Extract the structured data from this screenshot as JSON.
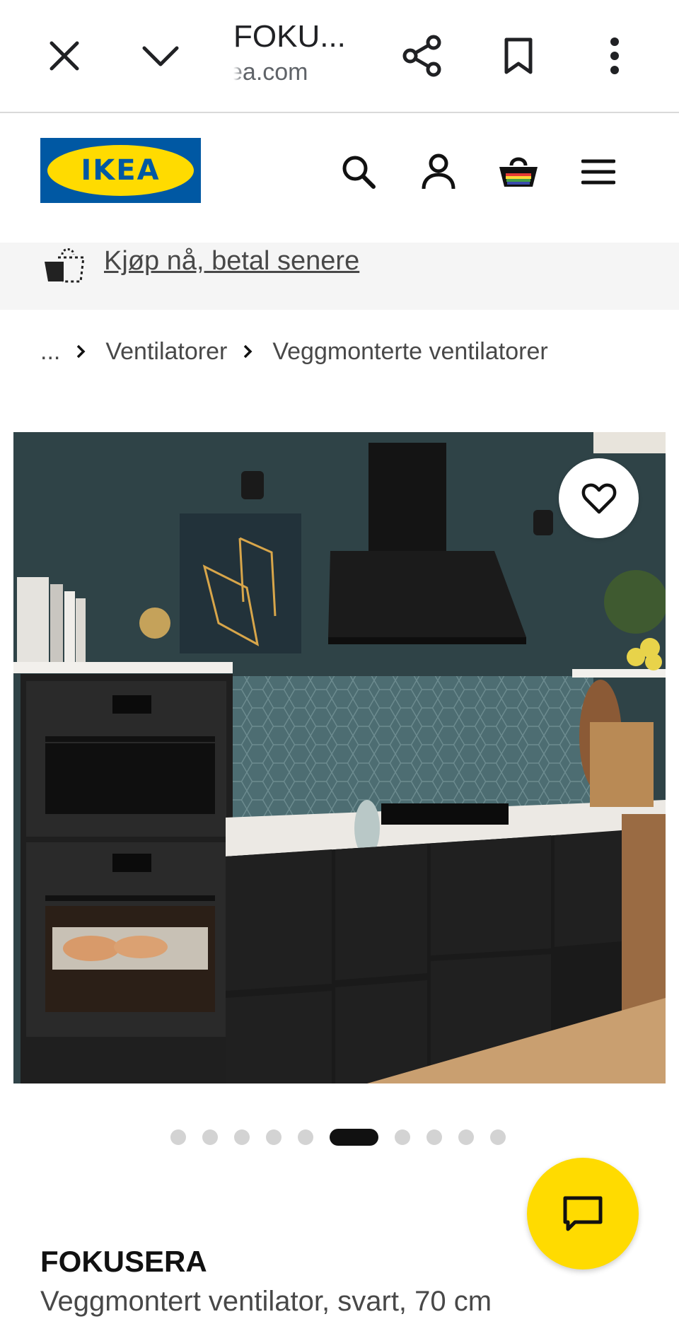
{
  "browser": {
    "title": "FOKU...",
    "url": "ea.com",
    "close_icon": "close-icon",
    "minimize_icon": "chevron-down-icon",
    "share_icon": "share-icon",
    "bookmark_icon": "bookmark-icon",
    "more_icon": "more-vert-icon"
  },
  "header": {
    "logo_text": "IKEA",
    "brand_blue": "#0058a3",
    "brand_yellow": "#ffdb00",
    "icons": [
      "search-icon",
      "account-icon",
      "cart-icon",
      "menu-icon"
    ]
  },
  "promo": {
    "text": "Kjøp nå, betal senere"
  },
  "breadcrumb": {
    "ellipsis": "...",
    "items": [
      "Ventilatorer",
      "Veggmonterte ventilatorer"
    ]
  },
  "carousel": {
    "total": 10,
    "active_index": 5
  },
  "product": {
    "name": "FOKUSERA",
    "description": "Veggmontert ventilator, svart, 70 cm"
  }
}
